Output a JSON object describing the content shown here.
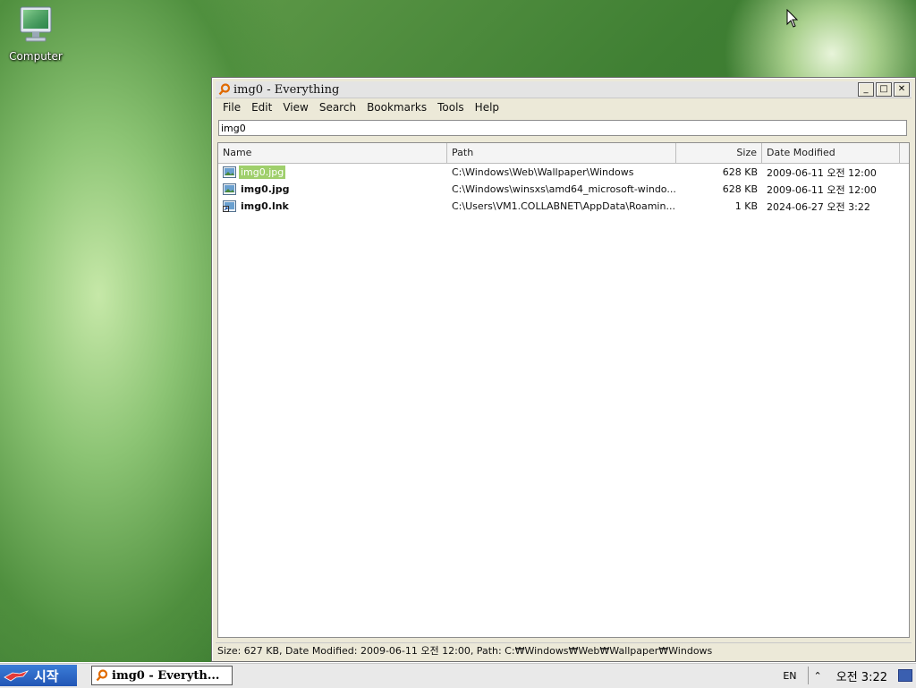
{
  "desktop": {
    "icons": [
      {
        "label": "Computer",
        "icon": "computer-icon"
      }
    ]
  },
  "window": {
    "title": "img0 - Everything",
    "app_icon": "magnifier-icon",
    "controls": {
      "minimize": "_",
      "maximize": "□",
      "close": "✕"
    },
    "menu": [
      "File",
      "Edit",
      "View",
      "Search",
      "Bookmarks",
      "Tools",
      "Help"
    ],
    "search": {
      "value": "img0"
    },
    "columns": {
      "name": "Name",
      "path": "Path",
      "size": "Size",
      "date": "Date Modified"
    },
    "rows": [
      {
        "name": "img0.jpg",
        "path": "C:\\Windows\\Web\\Wallpaper\\Windows",
        "size": "628 KB",
        "date": "2009-06-11 오전 12:00",
        "icon": "image-file-icon",
        "selected": true
      },
      {
        "name": "img0.jpg",
        "path": "C:\\Windows\\winsxs\\amd64_microsoft-windo...",
        "size": "628 KB",
        "date": "2009-06-11 오전 12:00",
        "icon": "image-file-icon",
        "selected": false
      },
      {
        "name": "img0.lnk",
        "path": "C:\\Users\\VM1.COLLABNET\\AppData\\Roamin...",
        "size": "1 KB",
        "date": "2024-06-27 오전 3:22",
        "icon": "shortcut-file-icon",
        "selected": false
      }
    ],
    "status": "Size: 627 KB, Date Modified: 2009-06-11 오전 12:00, Path: C:₩Windows₩Web₩Wallpaper₩Windows"
  },
  "taskbar": {
    "start_label": "시작",
    "task_button": "img0 - Everyth...",
    "language": "EN",
    "tray_arrow": "⌃",
    "clock": "오전 3:22"
  },
  "colors": {
    "selection": "#9fcf6c",
    "start_button": "#2a62c4"
  }
}
